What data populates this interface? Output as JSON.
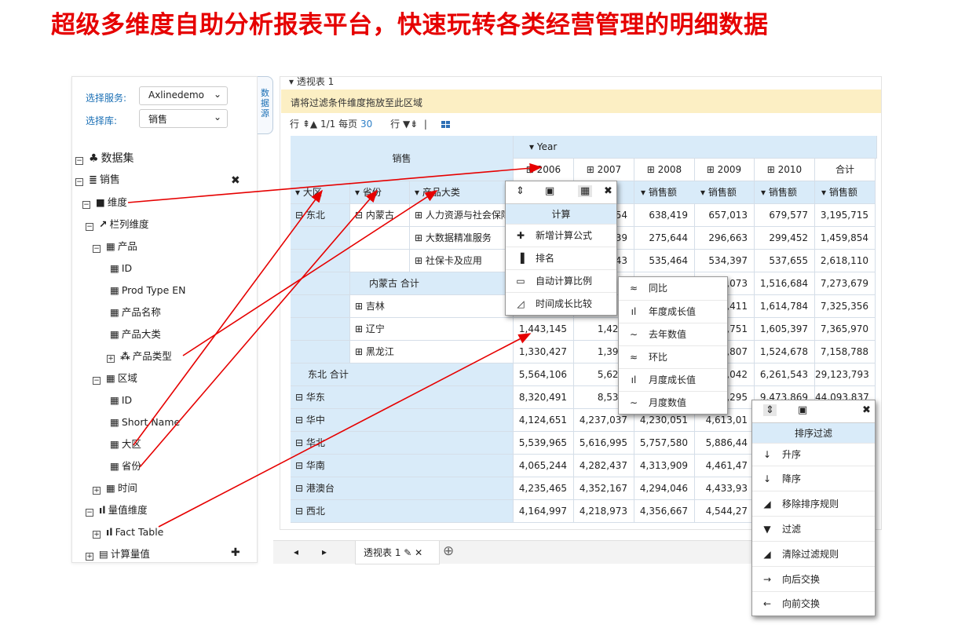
{
  "headline": "超级多维度自助分析报表平台，快速玩转各类经营管理的明细数据",
  "left": {
    "service_label": "选择服务:",
    "service_value": "Axlinedemo",
    "db_label": "选择库:",
    "db_value": "销售",
    "tree": {
      "dataset": "数据集",
      "sales": "销售",
      "dimension": "维度",
      "col_dim": "栏列维度",
      "product": "产品",
      "id": "ID",
      "prod_type_en": "Prod Type EN",
      "product_name": "产品名称",
      "product_category": "产品大类",
      "product_type": "产品类型",
      "region": "区域",
      "region_id": "ID",
      "short_name": "Short Name",
      "big_region": "大区",
      "province": "省份",
      "time": "时间",
      "measure_dim": "量值维度",
      "fact_table": "Fact Table",
      "calc_measure": "计算量值"
    }
  },
  "side_tab": "数据源",
  "main": {
    "pivot_title": "透视表 1",
    "filter_hint": "请将过滤条件维度拖放至此区域",
    "toolbar": {
      "row": "行",
      "page_info": "1/1 每页",
      "page_size": "30",
      "row2": "行"
    },
    "year_label": "Year",
    "sales_label": "销售",
    "years": [
      "2006",
      "2007",
      "2008",
      "2009",
      "2010",
      "合计"
    ],
    "row_headers": [
      "大区",
      "省份",
      "产品大类"
    ],
    "measure": "销售额",
    "rows": [
      {
        "r1": "东北",
        "r2": "内蒙古",
        "r3": "人力资源与社会保障",
        "v": [
          "",
          "54",
          "638,419",
          "657,013",
          "679,577",
          "3,195,715"
        ]
      },
      {
        "r3": "大数据精准服务",
        "v": [
          "",
          "39",
          "275,644",
          "296,663",
          "299,452",
          "1,459,854"
        ]
      },
      {
        "r3": "社保卡及应用",
        "v": [
          "",
          "43",
          "535,464",
          "534,397",
          "537,655",
          "2,618,110"
        ]
      },
      {
        "r2": "内蒙古 合计",
        "v": [
          "",
          "",
          "",
          ",073",
          "1,516,684",
          "7,273,679"
        ]
      },
      {
        "r2": "吉林",
        "v": [
          "",
          "",
          "",
          ",411",
          "1,614,784",
          "7,325,356"
        ]
      },
      {
        "r2": "辽宁",
        "v": [
          "1,443,145",
          "1,424,",
          "",
          ",751",
          "1,605,397",
          "7,365,970"
        ]
      },
      {
        "r2": "黑龙江",
        "v": [
          "1,330,427",
          "1,399,",
          "",
          ",807",
          "1,524,678",
          "7,158,788"
        ]
      },
      {
        "r1": "东北 合计",
        "v": [
          "5,564,106",
          "5,625,",
          "",
          ",042",
          "6,261,543",
          "29,123,793"
        ]
      },
      {
        "r1": "华东",
        "v": [
          "8,320,491",
          "8,532,",
          "",
          ",295",
          "9,473,869",
          "44,093,837"
        ]
      },
      {
        "r1": "华中",
        "v": [
          "4,124,651",
          "4,237,037",
          "4,230,051",
          "4,613,01",
          "",
          ""
        ]
      },
      {
        "r1": "华北",
        "v": [
          "5,539,965",
          "5,616,995",
          "5,757,580",
          "5,886,44",
          "",
          ""
        ]
      },
      {
        "r1": "华南",
        "v": [
          "4,065,244",
          "4,282,437",
          "4,313,909",
          "4,461,47",
          "",
          ""
        ]
      },
      {
        "r1": "港澳台",
        "v": [
          "4,235,465",
          "4,352,167",
          "4,294,046",
          "4,433,93",
          "",
          ""
        ]
      },
      {
        "r1": "西北",
        "v": [
          "4,164,997",
          "4,218,973",
          "4,356,667",
          "4,544,27",
          "",
          ""
        ]
      }
    ]
  },
  "bottom": {
    "tab_label": "透视表 1"
  },
  "calc_popup": {
    "title": "计算",
    "items": [
      "新增计算公式",
      "排名",
      "自动计算比例",
      "时间成长比较"
    ]
  },
  "time_popup": {
    "items": [
      "同比",
      "年度成长值",
      "去年数值",
      "环比",
      "月度成长值",
      "月度数值"
    ]
  },
  "sort_popup": {
    "title": "排序过滤",
    "items": [
      "升序",
      "降序",
      "移除排序规则",
      "过滤",
      "清除过滤规则",
      "向后交换",
      "向前交换"
    ]
  },
  "colors": {
    "headline": "#e60000",
    "header_bg": "#d9ebf9",
    "filter_bg": "#fcefc4",
    "arrow": "#e60000"
  }
}
